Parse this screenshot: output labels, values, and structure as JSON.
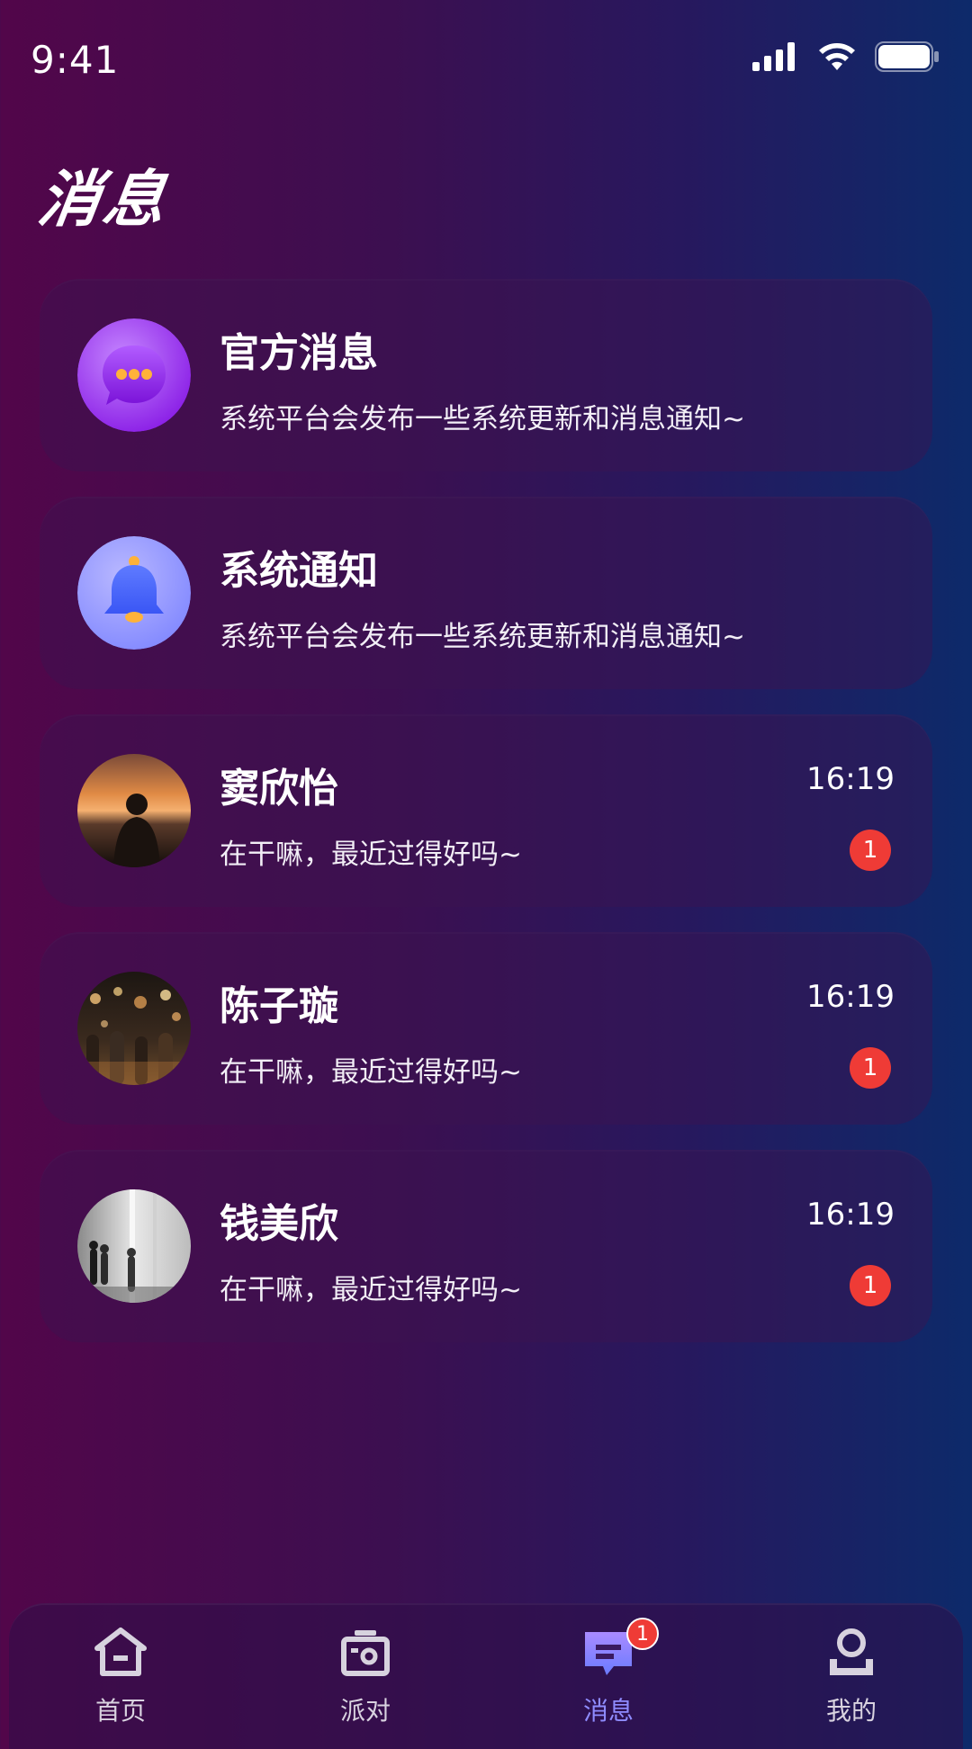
{
  "status_bar": {
    "time": "9:41"
  },
  "page": {
    "title": "消息"
  },
  "system_items": [
    {
      "title": "官方消息",
      "subtitle": "系统平台会发布一些系统更新和消息通知~",
      "icon": "chat-bubble-icon"
    },
    {
      "title": "系统通知",
      "subtitle": "系统平台会发布一些系统更新和消息通知~",
      "icon": "bell-icon"
    }
  ],
  "conversations": [
    {
      "name": "窦欣怡",
      "message": "在干嘛，最近过得好吗~",
      "time": "16:19",
      "unread": "1"
    },
    {
      "name": "陈子璇",
      "message": "在干嘛，最近过得好吗~",
      "time": "16:19",
      "unread": "1"
    },
    {
      "name": "钱美欣",
      "message": "在干嘛，最近过得好吗~",
      "time": "16:19",
      "unread": "1"
    }
  ],
  "tab_bar": {
    "tabs": [
      {
        "label": "首页",
        "icon": "home-icon"
      },
      {
        "label": "派对",
        "icon": "radio-icon"
      },
      {
        "label": "消息",
        "icon": "message-icon",
        "badge": "1",
        "active": true
      },
      {
        "label": "我的",
        "icon": "profile-icon"
      }
    ]
  },
  "colors": {
    "badge": "#ef3b36",
    "active_tab": "#8f8cff"
  }
}
